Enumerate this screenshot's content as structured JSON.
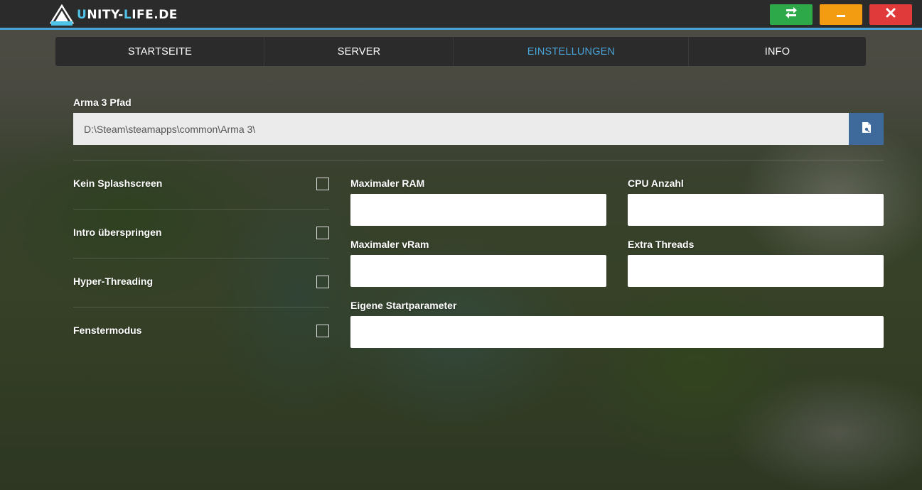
{
  "app": {
    "brand_prefix": "U",
    "brand_mid": "NITY-",
    "brand_accent": "L",
    "brand_suffix": "IFE.DE",
    "logo_text": "UNITY-LIFE"
  },
  "window_controls": {
    "refresh_icon": "refresh-icon",
    "minimize_icon": "minimize-icon",
    "close_icon": "close-icon"
  },
  "nav": {
    "tabs": [
      {
        "label": "STARTSEITE"
      },
      {
        "label": "SERVER"
      },
      {
        "label": "EINSTELLUNGEN",
        "active": true
      },
      {
        "label": "INFO"
      }
    ]
  },
  "settings": {
    "arma_path_label": "Arma 3 Pfad",
    "arma_path_value": "D:\\Steam\\steamapps\\common\\Arma 3\\",
    "browse_icon": "file-icon",
    "options": [
      {
        "label": "Kein Splashscreen",
        "checked": false
      },
      {
        "label": "Intro überspringen",
        "checked": false
      },
      {
        "label": "Hyper-Threading",
        "checked": false
      },
      {
        "label": "Fenstermodus",
        "checked": false
      }
    ],
    "max_ram_label": "Maximaler RAM",
    "max_ram_value": "",
    "cpu_count_label": "CPU Anzahl",
    "cpu_count_value": "",
    "max_vram_label": "Maximaler vRam",
    "max_vram_value": "",
    "extra_threads_label": "Extra Threads",
    "extra_threads_value": "",
    "custom_params_label": "Eigene Startparameter",
    "custom_params_value": ""
  },
  "colors": {
    "accent": "#4aa3d6",
    "refresh": "#2ea94a",
    "minimize": "#f39c12",
    "close": "#e03a3a",
    "browse": "#3d6a9a"
  }
}
